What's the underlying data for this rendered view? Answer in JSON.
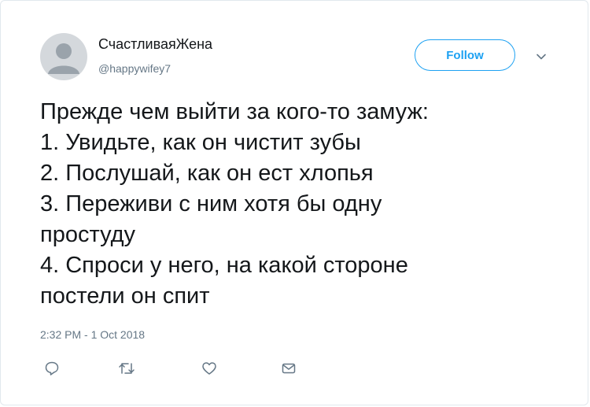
{
  "author": {
    "display_name": "СчастливаяЖена",
    "handle": "@happywifey7"
  },
  "follow_label": "Follow",
  "tweet": {
    "lines": [
      "Прежде чем выйти за кого-то замуж:",
      "1. Увидьте, как он чистит зубы",
      "2. Послушай, как он ест хлопья",
      "3. Переживи с ним хотя бы одну",
      "простуду",
      "4. Спроси у него, на какой стороне",
      "постели он спит"
    ],
    "timestamp": "2:32 PM - 1 Oct 2018"
  },
  "actions": [
    "reply-icon",
    "retweet-icon",
    "like-icon",
    "message-icon"
  ],
  "colors": {
    "accent": "#1da1f2",
    "text": "#14171a",
    "muted": "#657786",
    "border": "#e1e8ed"
  }
}
